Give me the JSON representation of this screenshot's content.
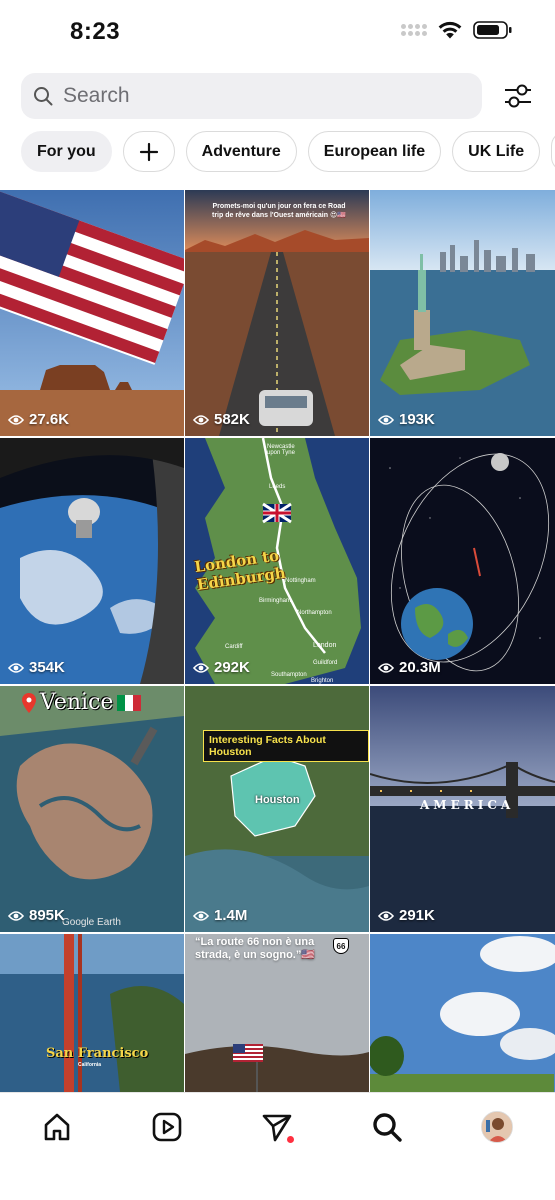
{
  "status_bar": {
    "time": "8:23"
  },
  "search": {
    "placeholder": "Search"
  },
  "icons": {
    "search": "search-icon",
    "filter": "filter-sliders-icon",
    "home": "home-icon",
    "reels": "reels-icon",
    "messages": "send-icon",
    "explore": "search-icon",
    "profile": "avatar"
  },
  "chips": [
    {
      "label": "For you",
      "active": true
    },
    {
      "label": "+",
      "icon": "plus-icon"
    },
    {
      "label": "Adventure"
    },
    {
      "label": "European life"
    },
    {
      "label": "UK Life"
    }
  ],
  "tiles": [
    {
      "views": "27.6K"
    },
    {
      "views": "582K",
      "caption": "Promets-moi qu'un jour on fera ce Road trip de rêve dans l'Ouest américain 😍🇺🇸"
    },
    {
      "views": "193K"
    },
    {
      "views": "354K"
    },
    {
      "views": "292K",
      "caption": "London to Edinburgh",
      "map_labels": [
        "Newcastle upon Tyne",
        "Leeds",
        "Nottingham",
        "Birmingham",
        "Northampton",
        "London",
        "Cardiff",
        "Southampton",
        "Brighton",
        "Guildford"
      ]
    },
    {
      "views": "20.3M"
    },
    {
      "views": "895K",
      "caption": "Venice",
      "watermark": "Google Earth"
    },
    {
      "views": "1.4M",
      "caption": "Interesting Facts About Houston",
      "map_label": "Houston"
    },
    {
      "views": "291K",
      "caption": "AMERICA"
    },
    {
      "views": "",
      "caption": "San Francisco",
      "subcaption": "California"
    },
    {
      "views": "",
      "caption": "“La route 66 non è una strada, è un sogno.”🇺🇸"
    },
    {
      "views": ""
    }
  ]
}
